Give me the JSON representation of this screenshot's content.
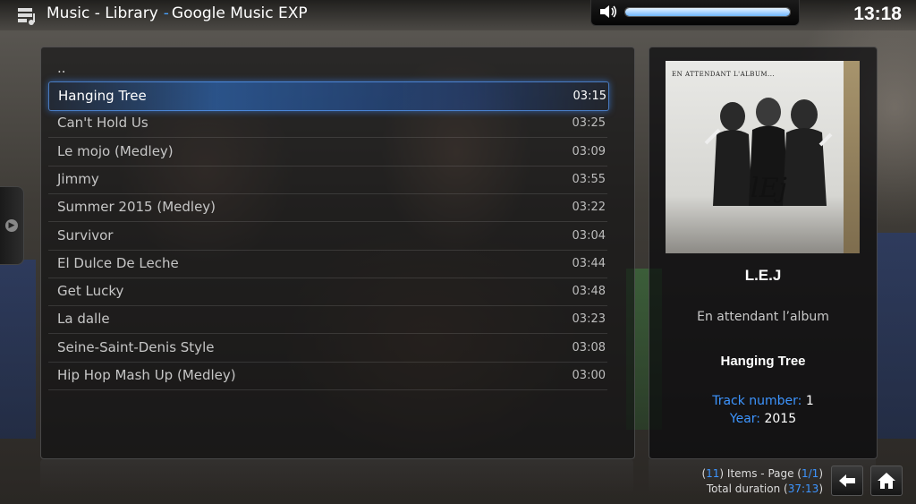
{
  "header": {
    "section": "Music - Library",
    "separator": "-",
    "addon": "Google Music EXP",
    "clock": "13:18"
  },
  "volume": {
    "level": 1.0
  },
  "list": {
    "parent_label": "..",
    "items": [
      {
        "title": "Hanging Tree",
        "duration": "03:15"
      },
      {
        "title": "Can't Hold Us",
        "duration": "03:25"
      },
      {
        "title": "Le mojo (Medley)",
        "duration": "03:09"
      },
      {
        "title": "Jimmy",
        "duration": "03:55"
      },
      {
        "title": "Summer 2015 (Medley)",
        "duration": "03:22"
      },
      {
        "title": "Survivor",
        "duration": "03:04"
      },
      {
        "title": "El Dulce De Leche",
        "duration": "03:44"
      },
      {
        "title": "Get Lucky",
        "duration": "03:48"
      },
      {
        "title": "La dalle",
        "duration": "03:23"
      },
      {
        "title": "Seine-Saint-Denis Style",
        "duration": "03:08"
      },
      {
        "title": "Hip Hop Mash Up (Medley)",
        "duration": "03:00"
      }
    ],
    "selected_index": 0
  },
  "info": {
    "album_art_caption": "EN ATTENDANT L'ALBUM...",
    "album_art_logo": "lEj",
    "artist": "L.E.J",
    "album": "En attendant l’album",
    "song": "Hanging Tree",
    "track_label": "Track number:",
    "track_value": "1",
    "year_label": "Year:",
    "year_value": "2015"
  },
  "footer": {
    "open_paren": "(",
    "items_count": "11",
    "items_text": ") Items - Page (",
    "page": "1/1",
    "close_paren": ")",
    "duration_label": "Total duration (",
    "total_duration": "37:13",
    "duration_close": ")"
  },
  "icons": {
    "app": "music-library-icon",
    "volume": "speaker-icon",
    "side": "play-circle-icon",
    "back": "back-arrow-icon",
    "home": "home-icon"
  },
  "colors": {
    "accent": "#3d95ff",
    "highlight": "#2d78dc"
  }
}
